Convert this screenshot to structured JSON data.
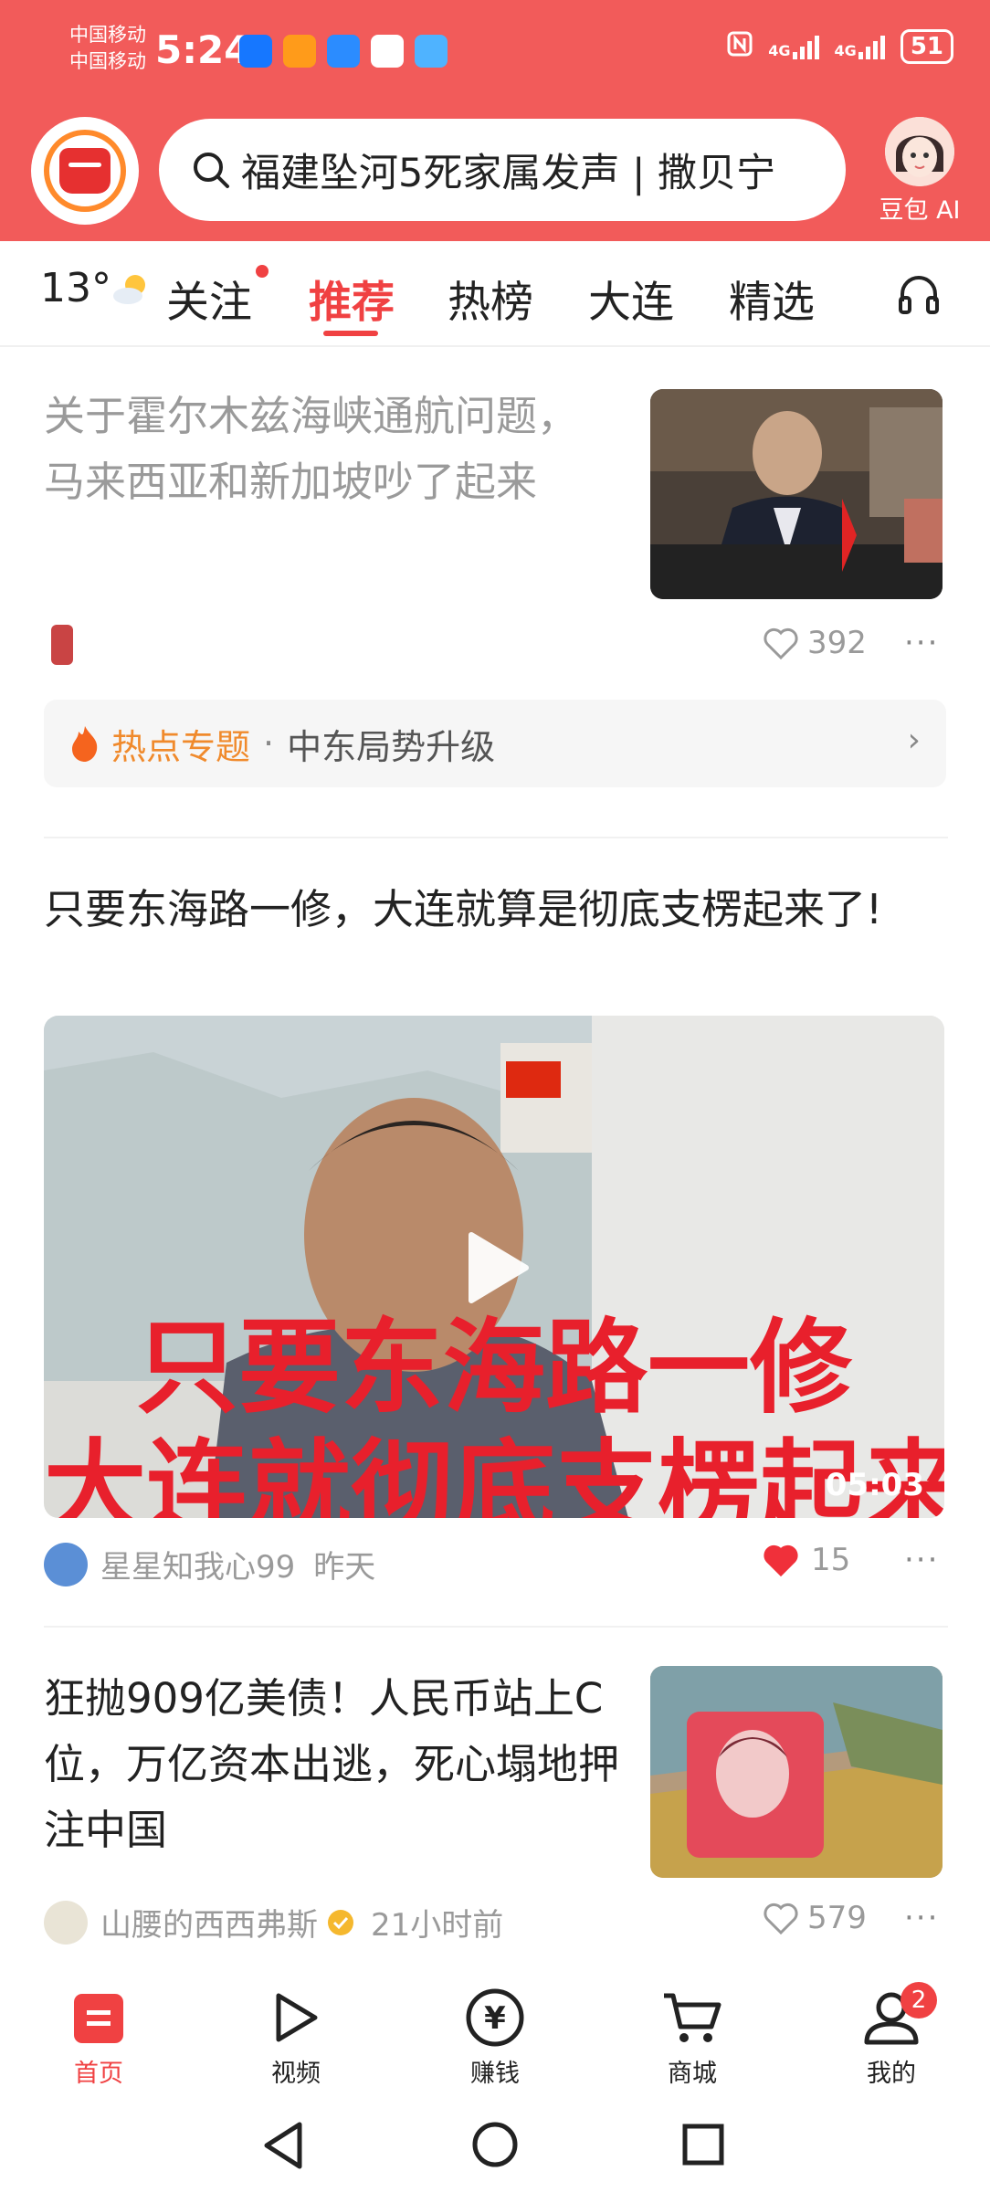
{
  "status_bar": {
    "carrier_1": "中国移动",
    "carrier_2": "中国移动",
    "time": "5:24",
    "network_1": "4G",
    "network_2": "4G",
    "battery": "51"
  },
  "header": {
    "search_text": "福建坠河5死家属发声 | 撒贝宁",
    "ai_label": "豆包 AI"
  },
  "tabs": {
    "weather_temp": "13°",
    "items": [
      "关注",
      "推荐",
      "热榜",
      "大连",
      "精选"
    ],
    "active": "推荐"
  },
  "articles": [
    {
      "title": "关于霍尔木兹海峡通航问题，马来西亚和新加坡吵了起来",
      "likes": "392"
    },
    {
      "title": "只要东海路一修，大连就算是彻底支楞起来了!",
      "video_caption_1": "只要东海路一修",
      "video_caption_2": "大连就彻底支楞起来",
      "duration": "05:03",
      "author": "星星知我心99",
      "time": "昨天",
      "likes": "15"
    },
    {
      "title": "狂抛909亿美债！人民币站上C位，万亿资本出逃，死心塌地押注中国",
      "author": "山腰的西西弗斯",
      "time": "21小时前",
      "likes": "579"
    }
  ],
  "hot_topic": {
    "label": "热点专题",
    "separator": "·",
    "text": "中东局势升级"
  },
  "bottom_nav": {
    "items": [
      "首页",
      "视频",
      "赚钱",
      "商城",
      "我的"
    ],
    "badge": "2"
  },
  "colors": {
    "brand_red": "#f04142",
    "header_bg": "#f25b5a",
    "hot_orange": "#f08a2c"
  }
}
